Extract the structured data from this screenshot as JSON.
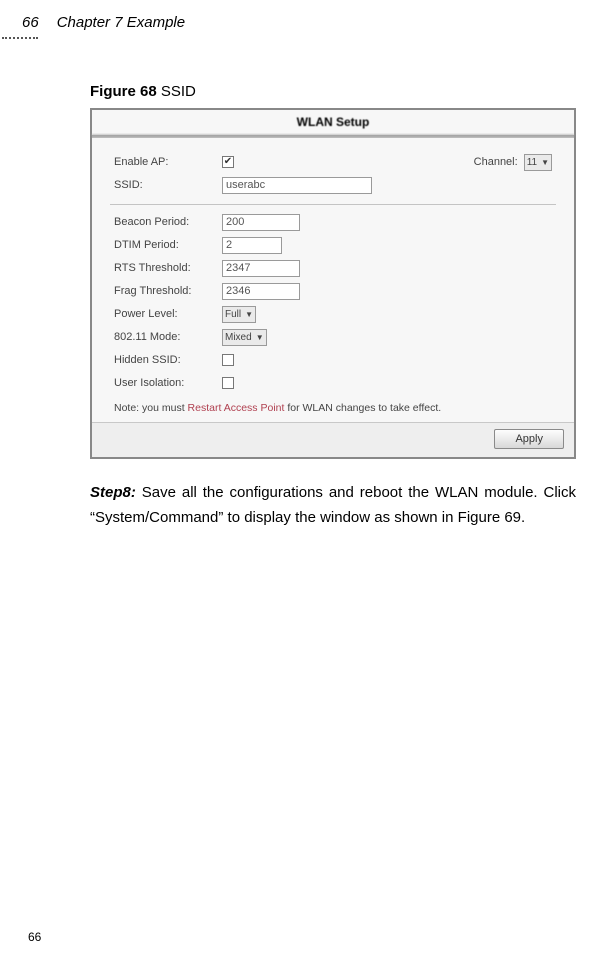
{
  "header": {
    "page_num_top": "66",
    "chapter": "Chapter 7 Example"
  },
  "figure": {
    "label_bold": "Figure 68",
    "label_rest": " SSID"
  },
  "wlan": {
    "panel_title": "WLAN Setup",
    "enable_ap_label": "Enable AP:",
    "channel_label": "Channel:",
    "channel_value": "11",
    "ssid_label": "SSID:",
    "ssid_value": "userabc",
    "beacon_label": "Beacon Period:",
    "beacon_value": "200",
    "dtim_label": "DTIM Period:",
    "dtim_value": "2",
    "rts_label": "RTS Threshold:",
    "rts_value": "2347",
    "frag_label": "Frag Threshold:",
    "frag_value": "2346",
    "power_label": "Power Level:",
    "power_value": "Full",
    "mode_label": "802.11 Mode:",
    "mode_value": "Mixed",
    "hidden_label": "Hidden SSID:",
    "iso_label": "User Isolation:",
    "note_prefix": "Note: you must ",
    "note_hot": "Restart Access Point",
    "note_suffix": " for WLAN changes to take effect.",
    "apply_label": "Apply"
  },
  "step": {
    "label": "Step8:",
    "text": " Save all the configurations and reboot the WLAN module. Click “System/Command” to display the window as shown in Figure 69."
  },
  "footer": {
    "page_num_bottom": "66"
  }
}
